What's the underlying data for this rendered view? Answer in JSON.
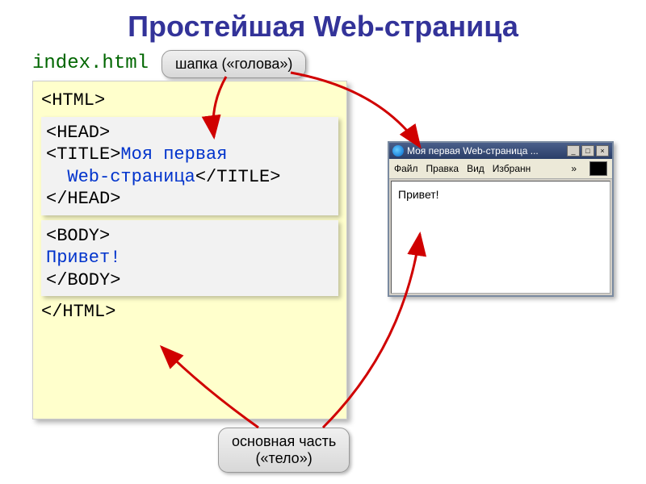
{
  "title": "Простейшая Web-страница",
  "filename": "index.html",
  "callouts": {
    "head": "шапка («голова»)",
    "body_line1": "основная часть",
    "body_line2": "(«тело»)"
  },
  "code": {
    "html_open": "<HTML>",
    "head_open": "<HEAD>",
    "title_open": "<TITLE>",
    "title_text1": "Моя первая",
    "title_text2": "Web-страница",
    "title_close": "</TITLE>",
    "head_close": "</HEAD>",
    "body_open": "<BODY>",
    "body_text": "Привет!",
    "body_close": "</BODY>",
    "html_close": "</HTML>"
  },
  "browser": {
    "window_title": "Моя первая Web-страница ...",
    "menu": {
      "file": "Файл",
      "edit": "Правка",
      "view": "Вид",
      "favorites": "Избранн",
      "more": "»"
    },
    "content": "Привет!"
  }
}
